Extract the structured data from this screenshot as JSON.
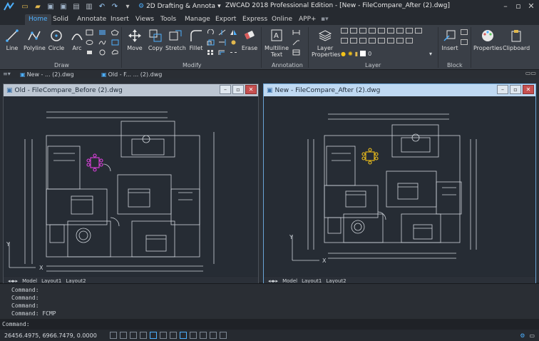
{
  "window": {
    "workspace": "2D Drafting & Annota",
    "title": "ZWCAD 2018 Professional Edition - [New - FileCompare_After (2).dwg]"
  },
  "ribbon_tabs": [
    "Home",
    "Solid",
    "Annotate",
    "Insert",
    "Views",
    "Tools",
    "Manage",
    "Export",
    "Express",
    "Online",
    "APP+"
  ],
  "ribbon": {
    "draw": {
      "line": "Line",
      "polyline": "Polyline",
      "circle": "Circle",
      "arc": "Arc",
      "group": "Draw"
    },
    "modify": {
      "move": "Move",
      "copy": "Copy",
      "stretch": "Stretch",
      "fillet": "Fillet",
      "erase": "Erase",
      "group": "Modify"
    },
    "annotation": {
      "mtext": "Multiline Text",
      "group": "Annotation"
    },
    "layer": {
      "properties": "Layer Properties",
      "current": "0",
      "group": "Layer"
    },
    "block": {
      "insert": "Insert",
      "group": "Block"
    },
    "properties": "Properties",
    "clipboard": "Clipboard"
  },
  "doc_tabs": [
    {
      "label": "New - ... (2).dwg"
    },
    {
      "label": "Old - F... ... (2).dwg"
    }
  ],
  "windows": {
    "left": {
      "title": "Old - FileCompare_Before (2).dwg"
    },
    "right": {
      "title": "New - FileCompare_After (2).dwg"
    }
  },
  "layout_tabs": [
    "Model",
    "Layout1",
    "Layout2"
  ],
  "command": {
    "history": [
      "Command:",
      "Command:",
      "Command:",
      "Command: FCMP"
    ],
    "prompt": "Command:"
  },
  "status": {
    "coords": "26456.4975, 6966.7479, 0.0000"
  },
  "colors": {
    "accent": "#4db0ff",
    "old_marker": "#e040e0",
    "new_marker": "#f2c21a"
  }
}
